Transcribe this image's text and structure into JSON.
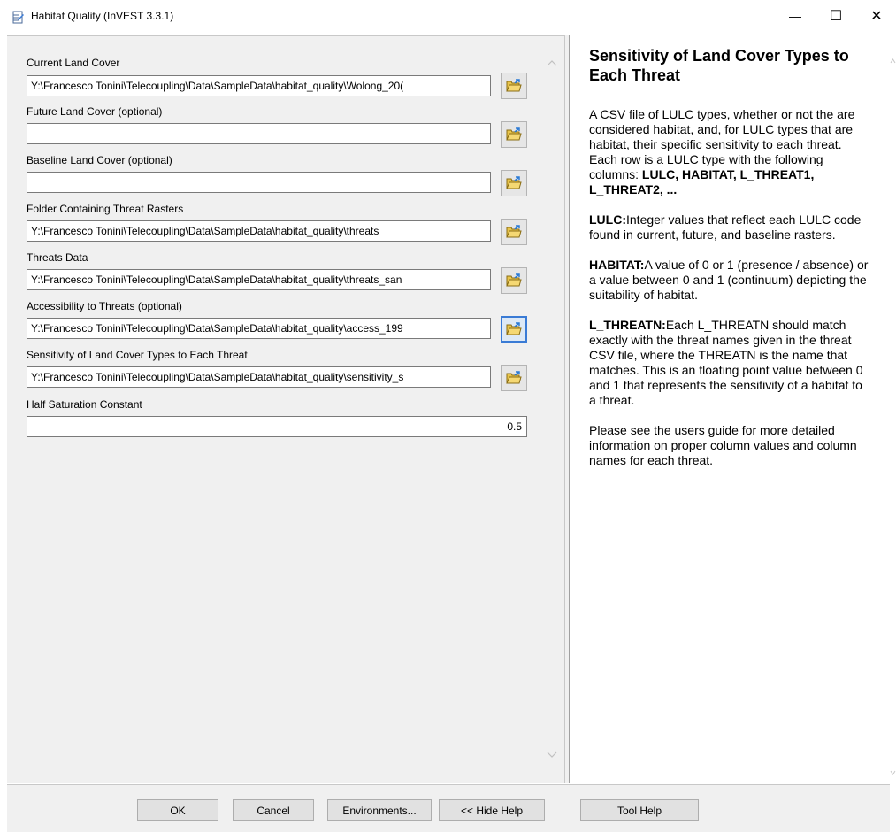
{
  "window": {
    "title": "Habitat Quality (InVEST 3.3.1)",
    "minimize_glyph": "—",
    "maximize_glyph": "☐",
    "close_glyph": "✕"
  },
  "form": {
    "fields": [
      {
        "label": "Current Land Cover",
        "value": "Y:\\Francesco Tonini\\Telecoupling\\Data\\SampleData\\habitat_quality\\Wolong_20("
      },
      {
        "label": "Future Land Cover (optional)",
        "value": ""
      },
      {
        "label": "Baseline Land Cover (optional)",
        "value": ""
      },
      {
        "label": "Folder Containing Threat Rasters",
        "value": "Y:\\Francesco Tonini\\Telecoupling\\Data\\SampleData\\habitat_quality\\threats"
      },
      {
        "label": "Threats Data",
        "value": "Y:\\Francesco Tonini\\Telecoupling\\Data\\SampleData\\habitat_quality\\threats_san"
      },
      {
        "label": "Accessibility to Threats (optional)",
        "value": "Y:\\Francesco Tonini\\Telecoupling\\Data\\SampleData\\habitat_quality\\access_199"
      },
      {
        "label": "Sensitivity of Land Cover Types to Each Threat",
        "value": "Y:\\Francesco Tonini\\Telecoupling\\Data\\SampleData\\habitat_quality\\sensitivity_s"
      }
    ],
    "half_saturation": {
      "label": "Half Saturation Constant",
      "value": "0.5"
    }
  },
  "help": {
    "title": "Sensitivity of Land Cover Types to Each Threat",
    "p1_text": "A CSV file of LULC types, whether or not the are considered habitat, and, for LULC types that are habitat, their specific sensitivity to each threat. Each row is a LULC type with the following columns:",
    "p1_bold": "LULC, HABITAT, L_THREAT1, L_THREAT2, ...",
    "p2_bold": "LULC:",
    "p2_text": "Integer values that reflect each LULC code found in current, future, and baseline rasters.",
    "p3_bold": "HABITAT:",
    "p3_text": "A value of 0 or 1 (presence / absence) or a value between 0 and 1 (continuum) depicting the suitability of habitat.",
    "p4_bold": "L_THREATN:",
    "p4_text": "Each L_THREATN should match exactly with the threat names given in the threat CSV file, where the THREATN is the name that matches. This is an floating point value between 0 and 1 that represents the sensitivity of a habitat to a threat.",
    "p5_text": "Please see the users guide for more detailed information on proper column values and column names for each threat."
  },
  "buttons": {
    "ok": "OK",
    "cancel": "Cancel",
    "environments": "Environments...",
    "hide_help": "<< Hide Help",
    "tool_help": "Tool Help"
  },
  "colors": {
    "panel_bg": "#f0f0f0",
    "focus_border": "#3a7bd5",
    "folder_yellow": "#e8c44a"
  }
}
